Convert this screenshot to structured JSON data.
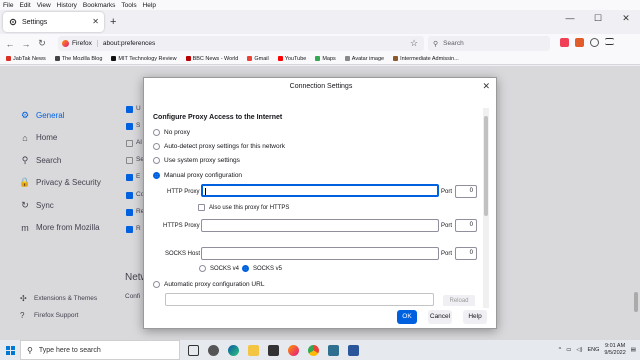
{
  "menubar": [
    "File",
    "Edit",
    "View",
    "History",
    "Bookmarks",
    "Tools",
    "Help"
  ],
  "tab": {
    "title": "Settings",
    "close": "✕"
  },
  "newtab": "+",
  "window_controls": [
    "—",
    "☐",
    "✕"
  ],
  "urlbar": {
    "badge": "Firefox",
    "url": "about:preferences"
  },
  "searchbar": {
    "placeholder": "Search"
  },
  "bookmarks": [
    {
      "label": "JabTak News",
      "color": "#d93025"
    },
    {
      "label": "The Mozilla Blog",
      "color": "#444"
    },
    {
      "label": "MIT Technology Review",
      "color": "#111"
    },
    {
      "label": "BBC News - World",
      "color": "#b80000"
    },
    {
      "label": "Gmail",
      "color": "#ea4335"
    },
    {
      "label": "YouTube",
      "color": "#ff0000"
    },
    {
      "label": "Maps",
      "color": "#34a853"
    },
    {
      "label": "Avatar image",
      "color": "#888"
    },
    {
      "label": "Intermediate Admissin...",
      "color": "#8b5a2b"
    }
  ],
  "sidebar": {
    "items": [
      {
        "label": "General",
        "icon": "⚙"
      },
      {
        "label": "Home",
        "icon": "⌂"
      },
      {
        "label": "Search",
        "icon": "⚲"
      },
      {
        "label": "Privacy & Security",
        "icon": "🔒"
      },
      {
        "label": "Sync",
        "icon": "↻"
      },
      {
        "label": "More from Mozilla",
        "icon": "m"
      }
    ],
    "bottom": [
      {
        "label": "Extensions & Themes",
        "icon": "✣"
      },
      {
        "label": "Firefox Support",
        "icon": "?"
      }
    ]
  },
  "background_fragments": {
    "network_heading": "Netw",
    "configure_fragment": "Confi",
    "fragments": [
      "U",
      "S",
      "Al",
      "Se",
      "E",
      "Co",
      "Re",
      "R"
    ]
  },
  "dialog": {
    "title": "Connection Settings",
    "close": "✕",
    "heading": "Configure Proxy Access to the Internet",
    "options": {
      "no_proxy": "No proxy",
      "auto_detect": "Auto-detect proxy settings for this network",
      "system": "Use system proxy settings",
      "manual": "Manual proxy configuration",
      "auto_url": "Automatic proxy configuration URL"
    },
    "http_proxy_label": "HTTP Proxy",
    "https_proxy_label": "HTTPS Proxy",
    "socks_host_label": "SOCKS Host",
    "port_label": "Port",
    "http_port": "0",
    "https_port": "0",
    "socks_port": "0",
    "also_https": "Also use this proxy for HTTPS",
    "socks_v4": "SOCKS v4",
    "socks_v5": "SOCKS v5",
    "reload": "Reload",
    "ok": "OK",
    "cancel": "Cancel",
    "help": "Help"
  },
  "taskbar": {
    "search_placeholder": "Type here to search",
    "language": "ENG",
    "time": "9:01 AM",
    "date": "9/5/2022"
  }
}
